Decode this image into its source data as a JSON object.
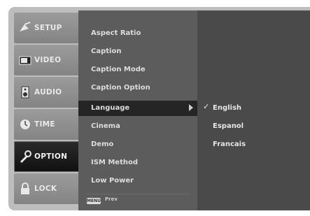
{
  "sidebar": {
    "items": [
      {
        "label": "SETUP",
        "icon": "satellite-dish-icon"
      },
      {
        "label": "VIDEO",
        "icon": "tv-icon"
      },
      {
        "label": "AUDIO",
        "icon": "speaker-icon"
      },
      {
        "label": "TIME",
        "icon": "clock-icon"
      },
      {
        "label": "OPTION",
        "icon": "wrench-icon"
      },
      {
        "label": "LOCK",
        "icon": "padlock-icon"
      }
    ],
    "active": "OPTION"
  },
  "menu": {
    "items": [
      "Aspect Ratio",
      "Caption",
      "Caption Mode",
      "Caption Option",
      "Language",
      "Cinema",
      "Demo",
      "ISM Method",
      "Low Power"
    ],
    "selected": "Language",
    "footer_button": "MENU",
    "footer_text": "Prev"
  },
  "submenu": {
    "items": [
      "English",
      "Espanol",
      "Francais"
    ],
    "selected": "English",
    "check": "✓"
  }
}
